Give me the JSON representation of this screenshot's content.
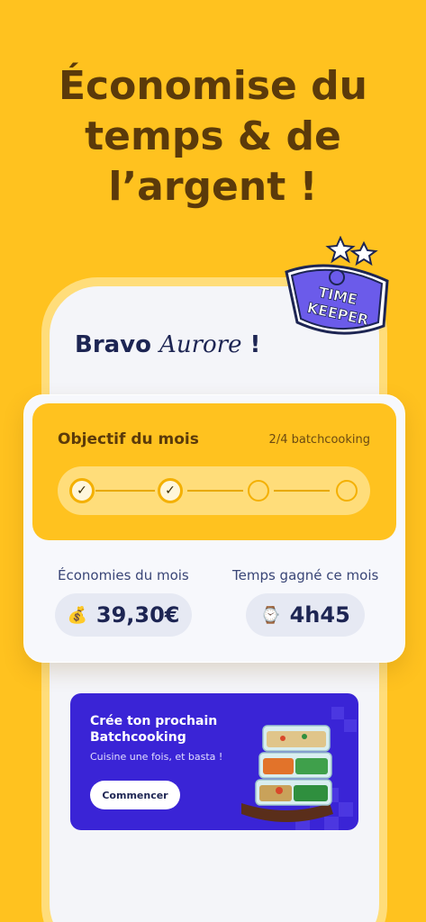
{
  "headline": {
    "line1": "Économise du",
    "line2": "temps & de",
    "line3": "l’argent !"
  },
  "badge": {
    "line1": "TIME",
    "line2": "KEEPER"
  },
  "greeting": {
    "prefix": "Bravo ",
    "name": "Aurore",
    "suffix": " !"
  },
  "goal": {
    "title": "Objectif du mois",
    "count": "2/4 batchcooking",
    "progress": 0.5,
    "steps": [
      true,
      true,
      false,
      false
    ]
  },
  "stats": {
    "savings_label": "Économies du mois",
    "savings_value": "39,30€",
    "savings_icon": "money-bag-icon",
    "time_label": "Temps gagné ce mois",
    "time_value": "4h45",
    "time_icon": "watch-icon"
  },
  "promo": {
    "title": "Crée ton prochain Batchcooking",
    "subtitle": "Cuisine une fois, et basta !",
    "button": "Commencer"
  },
  "colors": {
    "background": "#FFC21F",
    "headline": "#5B3A0A",
    "navy": "#1D2553",
    "promo": "#3A24D6",
    "badge": "#6B5BEA"
  }
}
